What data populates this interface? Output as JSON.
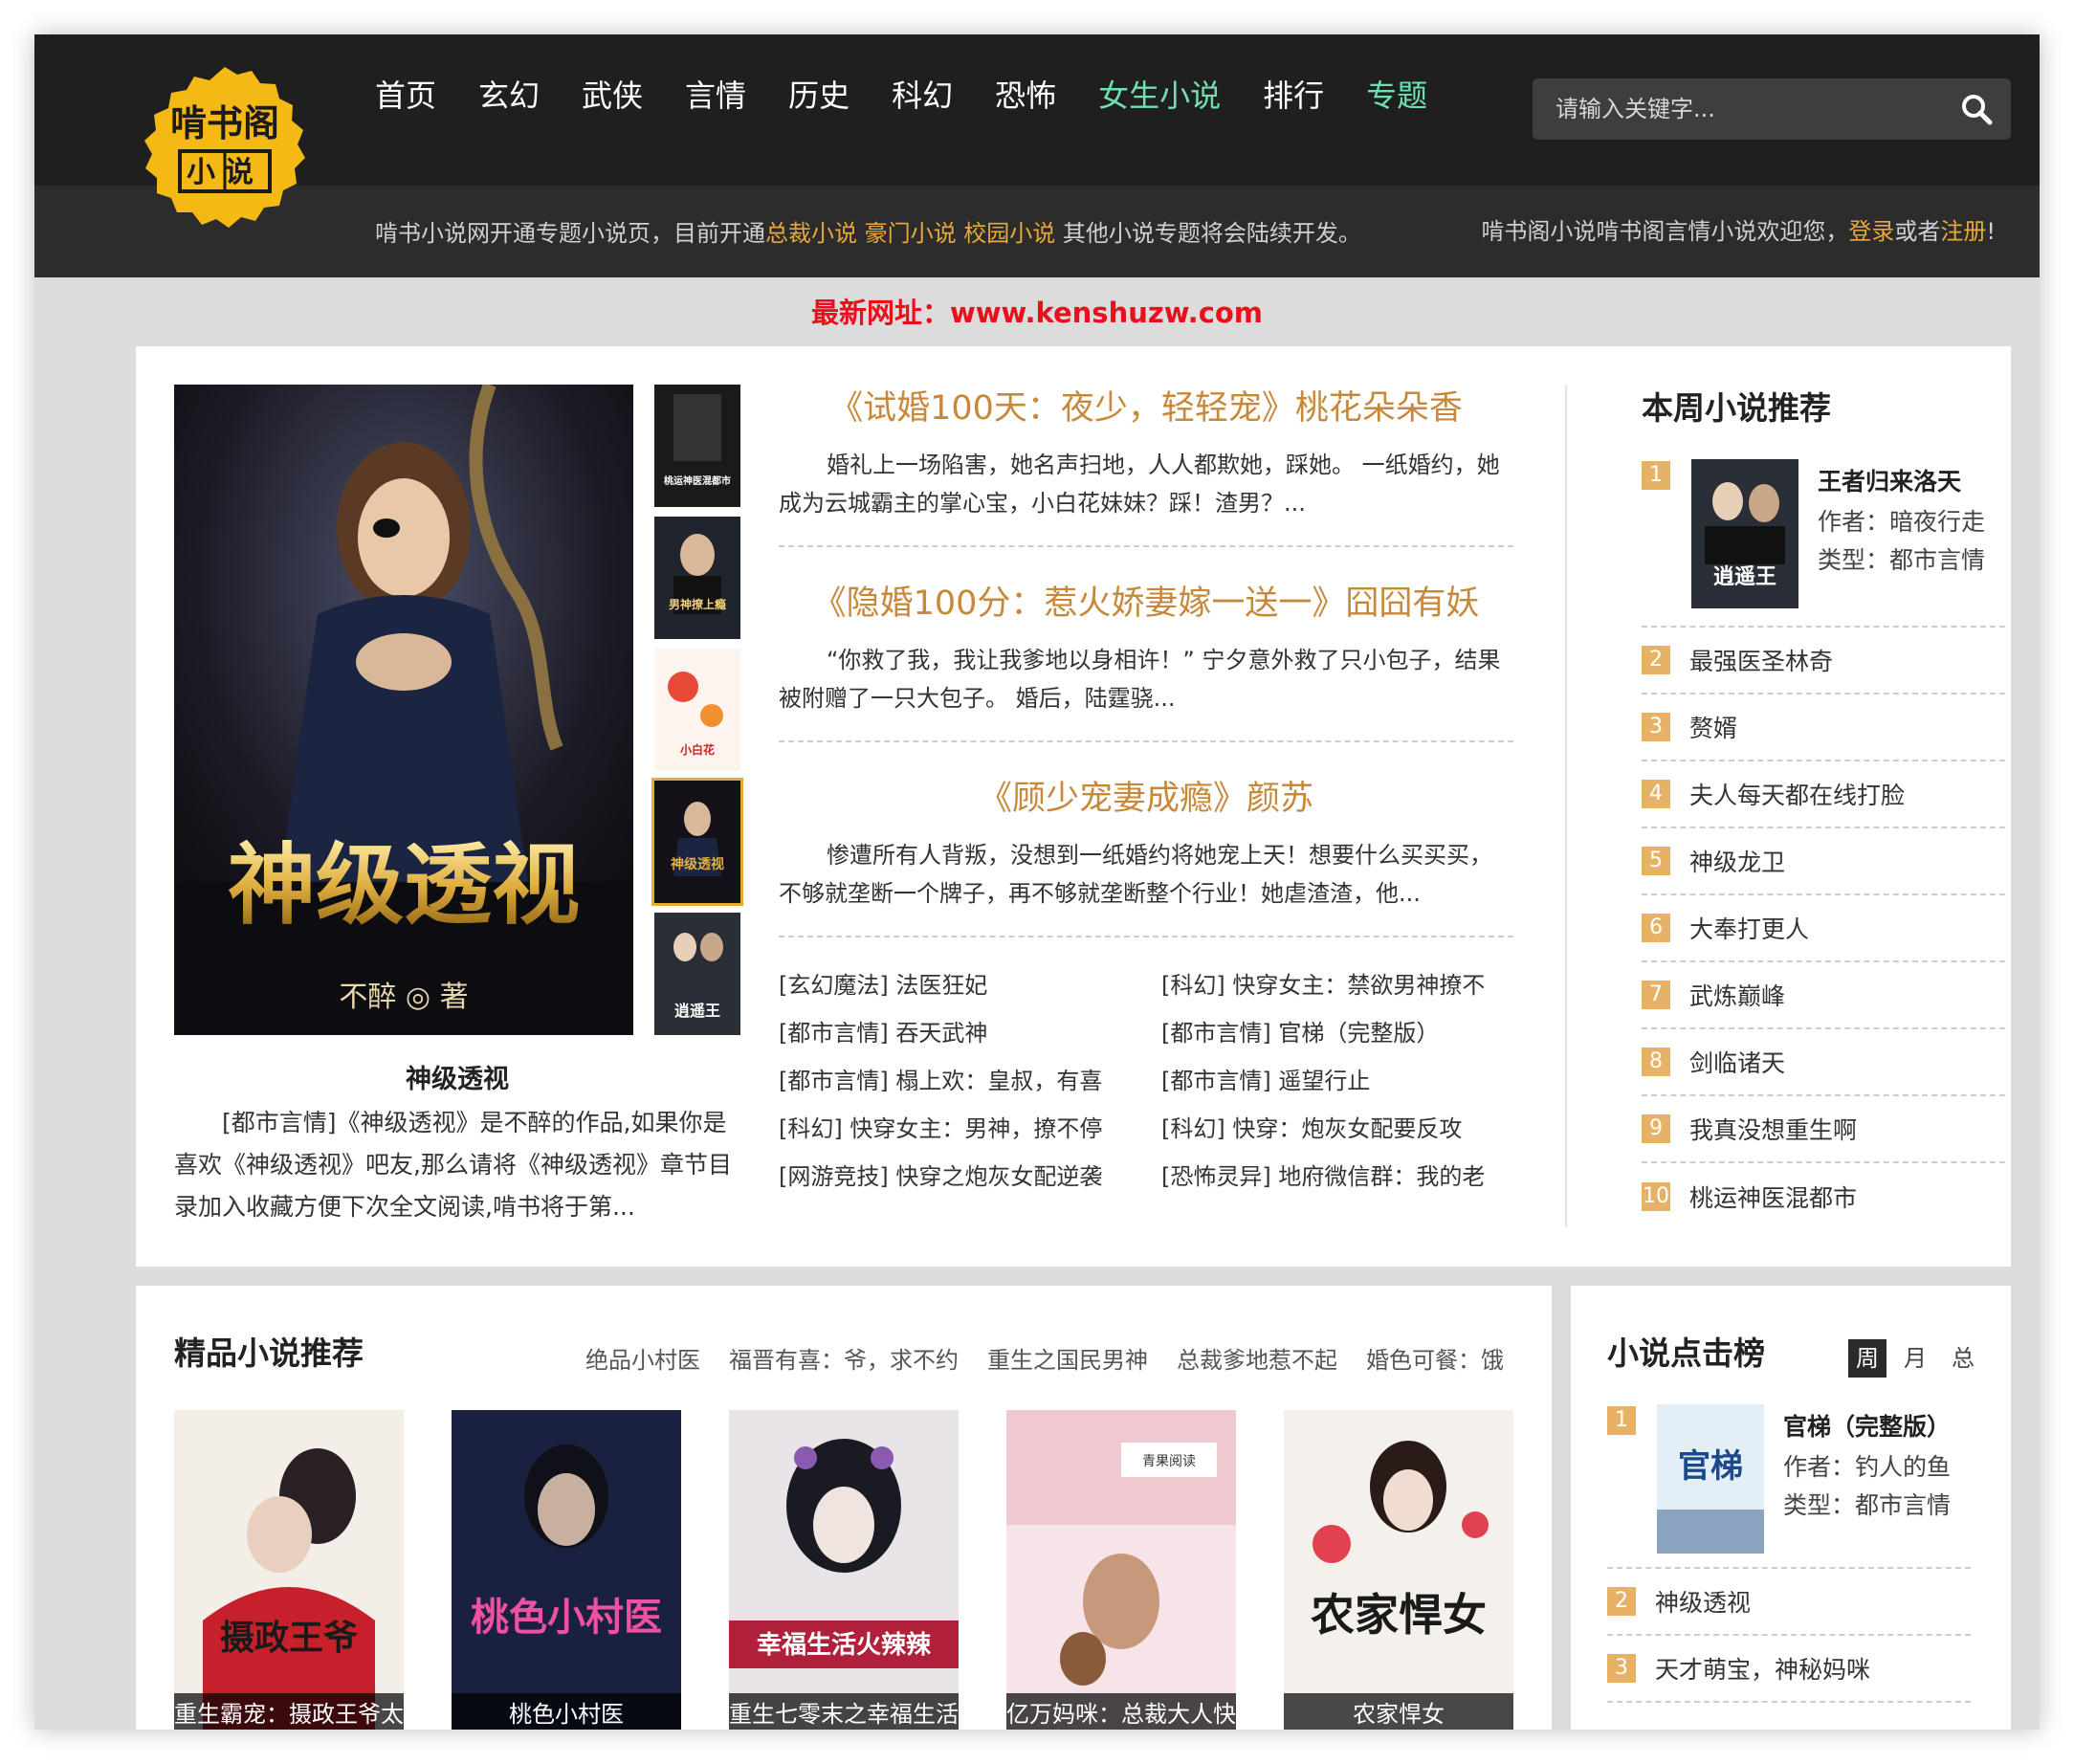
{
  "header": {
    "logo_text": "啃书阁",
    "logo_sub": "小说",
    "nav": [
      {
        "label": "首页",
        "highlight": false
      },
      {
        "label": "玄幻",
        "highlight": false
      },
      {
        "label": "武侠",
        "highlight": false
      },
      {
        "label": "言情",
        "highlight": false
      },
      {
        "label": "历史",
        "highlight": false
      },
      {
        "label": "科幻",
        "highlight": false
      },
      {
        "label": "恐怖",
        "highlight": false
      },
      {
        "label": "女生小说",
        "highlight": true
      },
      {
        "label": "排行",
        "highlight": false
      },
      {
        "label": "专题",
        "highlight": true
      }
    ],
    "search_placeholder": "请输入关键字..."
  },
  "subbar": {
    "notice_prefix": "啃书小说网开通专题小说页，目前开通",
    "notice_topic1": "总裁小说",
    "notice_topic2": "豪门小说",
    "notice_topic3": "校园小说",
    "notice_suffix": " 其他小说专题将会陆续开发。",
    "welcome_prefix": "啃书阁小说啃书阁言情小说欢迎您，",
    "login": "登录",
    "or": "或者",
    "register": "注册",
    "end": "!"
  },
  "new_url": "最新网址：www.kenshuzw.com",
  "featured": {
    "big_title": "神级透视",
    "big_cover_title": "神级透视",
    "big_cover_author": "不醉 ◎ 著",
    "big_desc": "[都市言情]《神级透视》是不醉的作品,如果你是喜欢《神级透视》吧友,那么请将《神级透视》章节目录加入收藏方便下次全文阅读,啃书将于第...",
    "thumbs": [
      "桃运神医混都市",
      "男神撩上瘾",
      "小白花",
      "神级透视",
      "逍遥王"
    ],
    "stories": [
      {
        "title": "《试婚100天：夜少，轻轻宠》桃花朵朵香",
        "desc": "婚礼上一场陷害，她名声扫地，人人都欺她，踩她。 一纸婚约，她成为云城霸主的掌心宝，小白花妹妹？踩！渣男？..."
      },
      {
        "title": "《隐婚100分：惹火娇妻嫁一送一》囧囧有妖",
        "desc": "“你救了我，我让我爹地以身相许！” 宁夕意外救了只小包子，结果被附赠了一只大包子。 婚后，陆霆骁..."
      },
      {
        "title": "《顾少宠妻成瘾》颜苏",
        "desc": "惨遭所有人背叛，没想到一纸婚约将她宠上天！想要什么买买买，不够就垄断一个牌子，再不够就垄断整个行业！她虐渣渣，他..."
      }
    ],
    "list": [
      "[玄幻魔法] 法医狂妃",
      "[科幻] 快穿女主：禁欲男神撩不",
      "[都市言情] 吞天武神",
      "[都市言情] 官梯（完整版）",
      "[都市言情] 榻上欢：皇叔，有喜",
      "[都市言情] 遥望行止",
      "[科幻] 快穿女主：男神，撩不停",
      "[科幻] 快穿：炮灰女配要反攻",
      "[网游竞技] 快穿之炮灰女配逆袭",
      "[恐怖灵异] 地府微信群：我的老"
    ]
  },
  "weekly": {
    "title": "本周小说推荐",
    "top": {
      "num": "1",
      "name": "王者归来洛天",
      "author": "作者：暗夜行走",
      "genre": "类型：都市言情",
      "cover_text": "逍遥王"
    },
    "items": [
      {
        "num": "2",
        "name": "最强医圣林奇"
      },
      {
        "num": "3",
        "name": "赘婿"
      },
      {
        "num": "4",
        "name": "夫人每天都在线打脸"
      },
      {
        "num": "5",
        "name": "神级龙卫"
      },
      {
        "num": "6",
        "name": "大奉打更人"
      },
      {
        "num": "7",
        "name": "武炼巅峰"
      },
      {
        "num": "8",
        "name": "剑临诸天"
      },
      {
        "num": "9",
        "name": "我真没想重生啊"
      },
      {
        "num": "10",
        "name": "桃运神医混都市"
      }
    ]
  },
  "premium": {
    "title": "精品小说推荐",
    "links": [
      "绝品小村医",
      "福晋有喜：爷，求不约",
      "重生之国民男神",
      "总裁爹地惹不起",
      "婚色可餐：饿"
    ],
    "covers": [
      {
        "caption": "重生霸宠：摄政王爷太",
        "art": "摄政王爷"
      },
      {
        "caption": "桃色小村医",
        "art": "桃色小村医"
      },
      {
        "caption": "重生七零末之幸福生活",
        "art": "幸福生活火辣辣"
      },
      {
        "caption": "亿万妈咪：总裁大人快",
        "art": "青果阅读"
      },
      {
        "caption": "农家悍女",
        "art": "农家悍女"
      }
    ]
  },
  "clicks": {
    "title": "小说点击榜",
    "tabs": [
      "周",
      "月",
      "总"
    ],
    "top": {
      "num": "1",
      "name": "官梯（完整版）",
      "author": "作者：钓人的鱼",
      "genre": "类型：都市言情",
      "cover_text": "官梯"
    },
    "items": [
      {
        "num": "2",
        "name": "神级透视"
      },
      {
        "num": "3",
        "name": "天才萌宝，神秘妈咪"
      }
    ]
  }
}
